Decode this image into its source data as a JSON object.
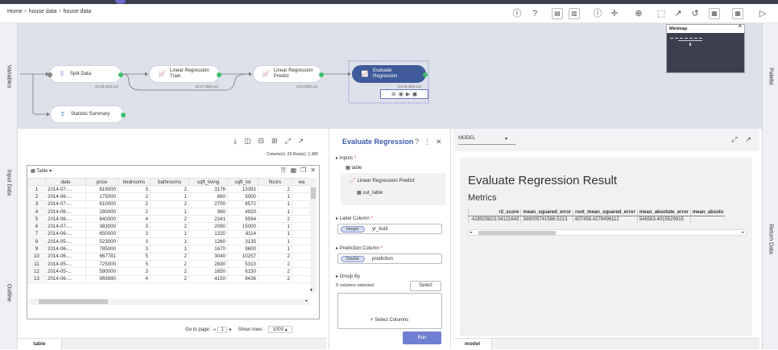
{
  "breadcrumb": [
    "Home",
    "house data",
    "house data"
  ],
  "side_tabs": {
    "variables": "Variables",
    "input_data": "Input Data",
    "outline": "Outline",
    "palette": "Palette",
    "return_data": "Return Data"
  },
  "minimap": {
    "title": "Minimap"
  },
  "nodes": {
    "split": {
      "label": "Split Data",
      "time": "22:48:42(0.1s)"
    },
    "lr_train": {
      "label": "Linear Regression Train",
      "time": "23:47:28(0.4s)"
    },
    "lr_predict": {
      "label": "Linear Regression Predict",
      "time": "23:6:28(0.1s)"
    },
    "evaluate": {
      "label": "Evaluate Regression",
      "time": "23:49:46(0.1s)"
    },
    "stat": {
      "label": "Statistic Summary"
    }
  },
  "table_panel": {
    "summary": "Column(s) :20   Row(s) :1,380",
    "view_label": "Table",
    "columns": [
      "",
      "date",
      "price",
      "bedrooms",
      "bathrooms",
      "sqft_living",
      "sqft_lot",
      "floors",
      "wa"
    ],
    "rows": [
      [
        "1",
        "2014-07-...",
        "819000",
        "3",
        "2",
        "3176",
        "13391",
        "2"
      ],
      [
        "2",
        "2014-06-...",
        "175000",
        "2",
        "1",
        "660",
        "5000",
        "1"
      ],
      [
        "3",
        "2014-07-...",
        "810000",
        "2",
        "2",
        "2700",
        "8572",
        "1"
      ],
      [
        "4",
        "2014-06-...",
        "280000",
        "2",
        "1",
        "960",
        "4920",
        "1"
      ],
      [
        "5",
        "2014-06-...",
        "640000",
        "4",
        "2",
        "2341",
        "9594",
        "2"
      ],
      [
        "6",
        "2014-07-...",
        "383000",
        "3",
        "2",
        "2090",
        "15000",
        "1"
      ],
      [
        "7",
        "2014-06-...",
        "650000",
        "3",
        "1",
        "1320",
        "8114",
        "1"
      ],
      [
        "8",
        "2014-05-...",
        "523000",
        "3",
        "1",
        "1260",
        "3135",
        "1"
      ],
      [
        "9",
        "2014-06-...",
        "785000",
        "3",
        "1",
        "1670",
        "9600",
        "1"
      ],
      [
        "10",
        "2014-06-...",
        "667781",
        "5",
        "2",
        "3040",
        "10257",
        "2"
      ],
      [
        "11",
        "2014-05-...",
        "725000",
        "5",
        "2",
        "2830",
        "5310",
        "2"
      ],
      [
        "12",
        "2014-05-...",
        "590000",
        "3",
        "2",
        "1650",
        "6150",
        "2"
      ],
      [
        "13",
        "2014-06-...",
        "969990",
        "4",
        "2",
        "4150",
        "8436",
        "2"
      ]
    ],
    "goto_label": "Go to page:",
    "page": "1",
    "show_rows_label": "Show rows:",
    "show_rows": "1000",
    "tab": "table"
  },
  "eval_panel": {
    "title": "Evaluate Regression",
    "inputs_label": "Inputs",
    "input_table": "table",
    "input_lrp": "Linear Regression Predict",
    "input_out": "out_table",
    "label_column_label": "Label Column",
    "label_type": "Integer",
    "label_value": "yr_built",
    "prediction_column_label": "Prediction Column",
    "pred_type": "Double",
    "pred_value": "prediction",
    "group_by_label": "Group By",
    "cols_selected": "0 columns selected",
    "select_btn": "Select",
    "select_columns": "+ Select Columns",
    "run_btn": "Run"
  },
  "model_panel": {
    "dropdown": "MODEL",
    "result_title": "Evaluate Regression Result",
    "metrics_label": "Metrics",
    "metric_headers": [
      "r2_score",
      "mean_squared_error",
      "root_mean_squared_error",
      "mean_absolute_error",
      "mean_absolu"
    ],
    "metric_values": [
      "-418503823.04121643",
      "369005741566.5213",
      "607458.4278496112",
      "546583.4015529915",
      ""
    ],
    "tab": "model"
  }
}
